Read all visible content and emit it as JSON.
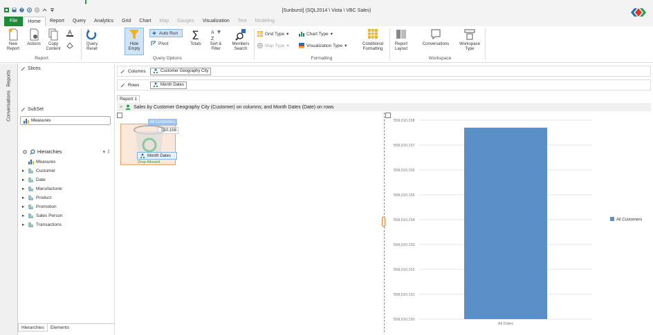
{
  "window": {
    "title": "[Sunburst]  (SQL2014 \\ Vista \\ VBC Sales)"
  },
  "tabs": [
    {
      "label": "File",
      "kind": "file"
    },
    {
      "label": "Home",
      "kind": "active"
    },
    {
      "label": "Report",
      "kind": "normal"
    },
    {
      "label": "Query",
      "kind": "normal"
    },
    {
      "label": "Analytics",
      "kind": "normal"
    },
    {
      "label": "Grid",
      "kind": "normal"
    },
    {
      "label": "Chart",
      "kind": "normal"
    },
    {
      "label": "Map",
      "kind": "dim"
    },
    {
      "label": "Gauges",
      "kind": "dim"
    },
    {
      "label": "Visualization",
      "kind": "normal"
    },
    {
      "label": "Text",
      "kind": "dim"
    },
    {
      "label": "Modeling",
      "kind": "dim"
    }
  ],
  "ribbon": {
    "new_report": "New\nReport",
    "actions": "Actions",
    "copy_content": "Copy\nContent",
    "group_report": "Report",
    "query_reset": "Query\nReset",
    "hide_empty": "Hide\nEmpty",
    "auto_run": "Auto Run",
    "pivot": "Pivot",
    "totals": "Totals",
    "sort_filter": "Sort &\nFilter",
    "members_search": "Members\nSearch",
    "group_query_options": "Query Options",
    "grid_type": "Grid Type",
    "chart_type": "Chart Type",
    "map_type": "Map Type",
    "visualization_type": "Visualization Type",
    "conditional_formatting": "Conditional\nFormatting",
    "group_formatting": "Formatting",
    "report_layout": "Report\nLayout",
    "conversations": "Conversations",
    "workspace_type": "Workspace\nType",
    "group_workspace": "Workspace"
  },
  "side_tabs": [
    "Reports",
    "Conversations"
  ],
  "left_pane": {
    "slices": "Slices",
    "subset": "SubSet",
    "subset_measure": "Measures",
    "hierarchies": "Hierarchies",
    "hierarchy_items": [
      "Measures",
      "Customer",
      "Date",
      "Manufacturer",
      "Product",
      "Promotion",
      "Sales Person",
      "Transactions"
    ],
    "tab_hierarchies": "Hierarchies",
    "tab_elements": "Elements"
  },
  "main": {
    "columns_label": "Columns",
    "columns_pill": "Customer Geography City",
    "rows_label": "Rows",
    "rows_pill": "Month Dates",
    "report_tab": "Report 1",
    "report_title": "Sales by Customer Geography City (Customer) on columns; and Month Dates (Date) on rows",
    "grid_header": "All Customers",
    "grid_value_fragment": "010,158",
    "drag_label": "Month Dates",
    "drop_allowed": "Drop Allowed"
  },
  "chart_data": {
    "type": "bar",
    "categories": [
      "All Dates"
    ],
    "series": [
      {
        "name": "All Customers",
        "values": [
          558010157.7
        ]
      }
    ],
    "ylim": [
      558010150,
      558010158
    ],
    "yticks": [
      "558,010,158",
      "558,010,157",
      "558,010,156",
      "558,010,155",
      "558,010,154",
      "558,010,153",
      "558,010,152",
      "558,010,151",
      "558,010,150"
    ],
    "legend_position": "right",
    "grid": true,
    "bar_color": "#5b8fc7"
  }
}
